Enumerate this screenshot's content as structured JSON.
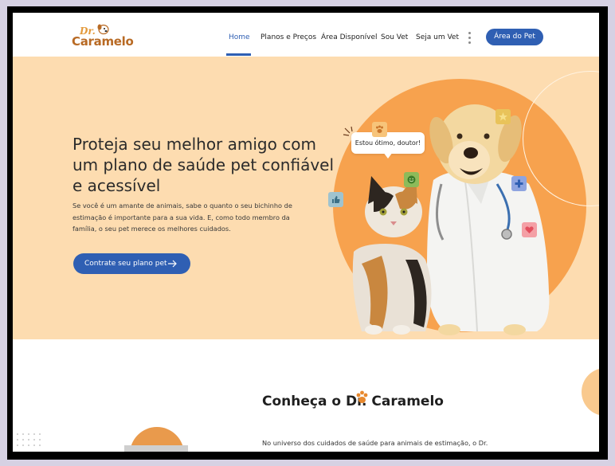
{
  "header": {
    "logo_prefix": "Dr.",
    "logo_name": "Caramelo",
    "nav": [
      {
        "label": "Home",
        "active": true
      },
      {
        "label": "Planos e Preços",
        "active": false
      },
      {
        "label": "Área Disponível",
        "active": false
      },
      {
        "label": "Sou Vet",
        "active": false
      },
      {
        "label": "Seja um Vet",
        "active": false
      }
    ],
    "cta_label": "Área do Pet"
  },
  "hero": {
    "title": "Proteja seu melhor amigo com um plano de saúde pet confiável e acessível",
    "text": "Se você é um amante de animais, sabe o quanto o seu bichinho de estimação é importante para a sua vida. E, como todo membro da família, o seu pet merece os melhores cuidados.",
    "cta_label": "Contrate seu plano pet",
    "bubble_text": "Estou ótimo, doutor!"
  },
  "about": {
    "title": "Conheça o Dr. Caramelo",
    "text": "No universo dos cuidados de saúde para animais de estimação, o Dr."
  },
  "colors": {
    "brand_blue": "#2f5fb3",
    "hero_bg": "#fddcb0",
    "accent_orange": "#f7a24e",
    "logo_brown": "#b86a24"
  },
  "icons": [
    "paw-icon",
    "smile-icon",
    "star-icon",
    "thumbs-up-icon",
    "plus-icon",
    "heart-icon",
    "arrow-right-icon",
    "kebab-menu-icon"
  ]
}
